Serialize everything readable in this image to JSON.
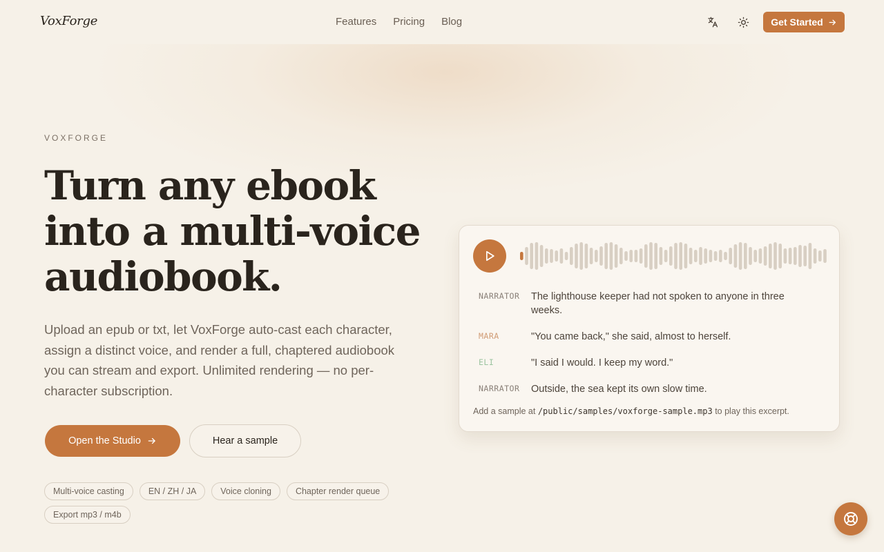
{
  "header": {
    "logo": "VoxForge",
    "nav": [
      "Features",
      "Pricing",
      "Blog"
    ],
    "translate_icon": "translate-icon",
    "theme_icon": "sun-icon",
    "cta_label": "Get Started"
  },
  "hero": {
    "eyebrow": "VOXFORGE",
    "headline": "Turn any ebook into a multi-voice audiobook.",
    "subtext": "Upload an epub or txt, let VoxForge auto-cast each character, assign a distinct voice, and render a full, chaptered audiobook you can stream and export. Unlimited rendering — no per-character subscription.",
    "primary_cta": "Open the Studio",
    "secondary_cta": "Hear a sample",
    "tags": [
      "Multi-voice casting",
      "EN / ZH / JA",
      "Voice cloning",
      "Chapter render queue",
      "Export mp3 / m4b"
    ]
  },
  "player": {
    "play_icon": "play-icon",
    "progress": 0,
    "lines": [
      {
        "speaker": "NARRATOR",
        "text": "The lighthouse keeper had not spoken to anyone in three weeks."
      },
      {
        "speaker": "MARA",
        "text": "\"You came back,\" she said, almost to herself."
      },
      {
        "speaker": "ELI",
        "text": "\"I said I would. I keep my word.\""
      },
      {
        "speaker": "NARRATOR",
        "text": "Outside, the sea kept its own slow time."
      }
    ],
    "footnote_prefix": "Add a sample at",
    "footnote_path": "/public/samples/voxforge-sample.mp3",
    "footnote_suffix": "to play this excerpt."
  },
  "help_icon": "lifebuoy-icon",
  "colors": {
    "accent": "#c5773e",
    "background": "#f6f1e8",
    "mara": "#d09b74",
    "eli": "#9cc4a0"
  }
}
